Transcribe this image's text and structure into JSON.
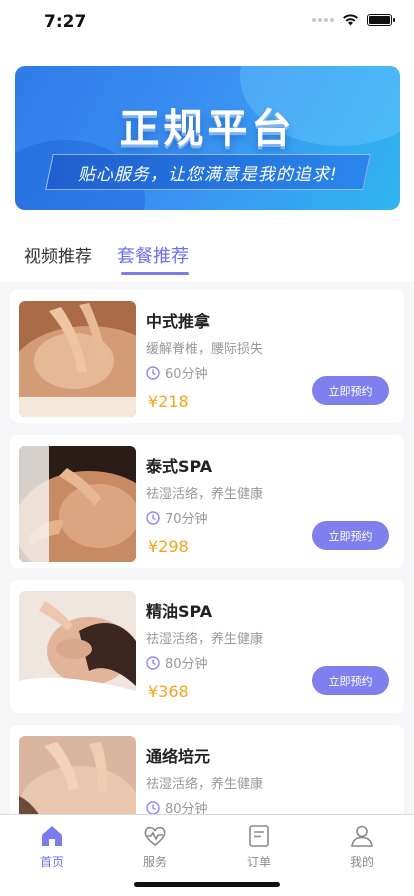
{
  "status_bar": {
    "time": "7:27"
  },
  "banner": {
    "title": "正规平台",
    "slogan": "贴心服务，让您满意是我的追求!"
  },
  "tabs": [
    {
      "label": "视频推荐",
      "active": false
    },
    {
      "label": "套餐推荐",
      "active": true
    }
  ],
  "packages": [
    {
      "name": "中式推拿",
      "desc": "缓解脊椎，腰际损失",
      "duration": "60分钟",
      "price": "¥218",
      "button": "立即预约"
    },
    {
      "name": "泰式SPA",
      "desc": "祛湿活络，养生健康",
      "duration": "70分钟",
      "price": "¥298",
      "button": "立即预约"
    },
    {
      "name": "精油SPA",
      "desc": "祛湿活络，养生健康",
      "duration": "80分钟",
      "price": "¥368",
      "button": "立即预约"
    },
    {
      "name": "通络培元",
      "desc": "祛湿活络，养生健康",
      "duration": "80分钟",
      "price": "",
      "button": ""
    }
  ],
  "tabbar": [
    {
      "label": "首页",
      "icon": "home-icon",
      "active": true
    },
    {
      "label": "服务",
      "icon": "heart-pulse-icon",
      "active": false
    },
    {
      "label": "订单",
      "icon": "order-icon",
      "active": false
    },
    {
      "label": "我的",
      "icon": "user-icon",
      "active": false
    }
  ],
  "colors": {
    "accent": "#7f80ee",
    "price": "#f3a51a",
    "banner": "#2f7be8"
  }
}
